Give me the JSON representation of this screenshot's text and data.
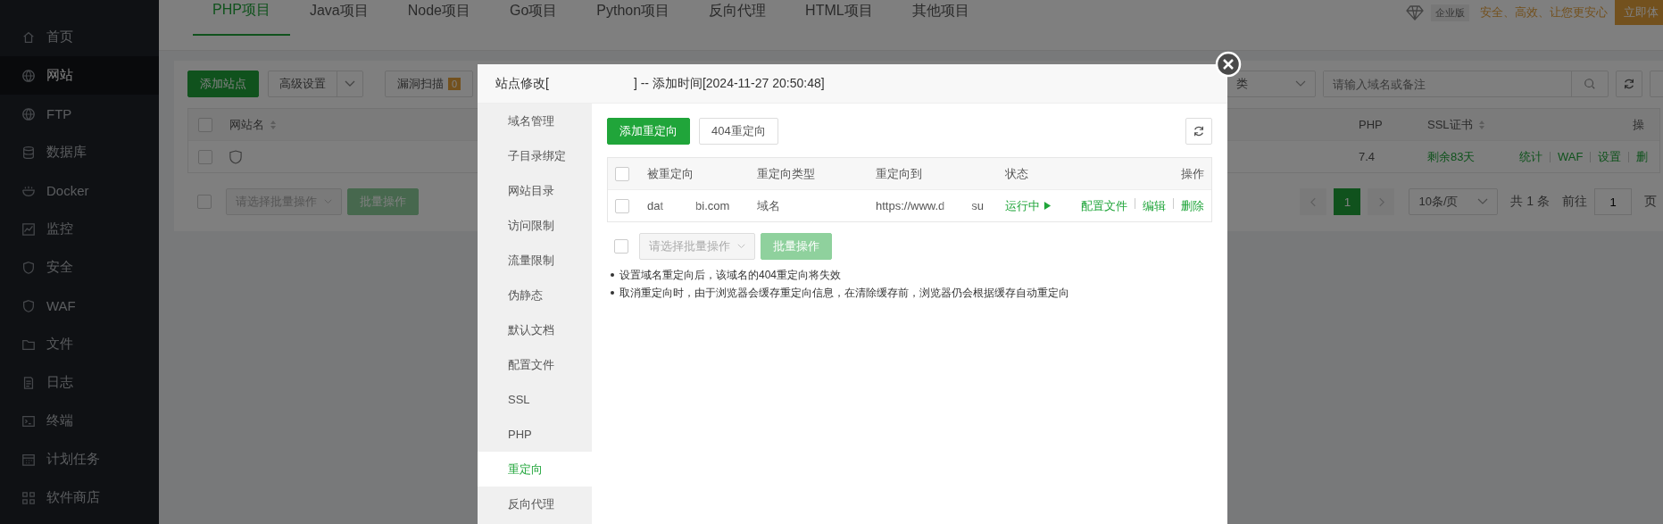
{
  "sidebar": {
    "items": [
      {
        "label": "首页",
        "selected": false
      },
      {
        "label": "网站",
        "selected": true
      },
      {
        "label": "FTP",
        "selected": false
      },
      {
        "label": "数据库",
        "selected": false
      },
      {
        "label": "Docker",
        "selected": false
      },
      {
        "label": "监控",
        "selected": false
      },
      {
        "label": "安全",
        "selected": false
      },
      {
        "label": "WAF",
        "selected": false
      },
      {
        "label": "文件",
        "selected": false
      },
      {
        "label": "日志",
        "selected": false
      },
      {
        "label": "终端",
        "selected": false
      },
      {
        "label": "计划任务",
        "selected": false
      },
      {
        "label": "软件商店",
        "selected": false
      }
    ]
  },
  "top_tabs": [
    {
      "label": "PHP项目",
      "selected": true
    },
    {
      "label": "Java项目",
      "selected": false
    },
    {
      "label": "Node项目",
      "selected": false
    },
    {
      "label": "Go项目",
      "selected": false
    },
    {
      "label": "Python项目",
      "selected": false
    },
    {
      "label": "反向代理",
      "selected": false
    },
    {
      "label": "HTML项目",
      "selected": false
    },
    {
      "label": "其他项目",
      "selected": false
    }
  ],
  "promo": {
    "edition_badge": "企业版",
    "slogan": "安全、高效、让您更安心",
    "button": "立即体"
  },
  "toolbar": {
    "add_site": "添加站点",
    "advanced": "高级设置",
    "scan": "漏洞扫描",
    "scan_count": "0",
    "category_select": "类",
    "search": {
      "placeholder": "请输入域名或备注"
    }
  },
  "site_table": {
    "header_checked": false,
    "columns": [
      {
        "label": "网站名",
        "sortable": true
      },
      {
        "label": "PHP",
        "sortable": false
      },
      {
        "label": "SSL证书",
        "sortable": true
      },
      {
        "label": "操",
        "sortable": false
      }
    ],
    "rows": [
      {
        "checked": false,
        "php": "7.4",
        "ssl": "剩余83天",
        "actions": [
          "统计",
          "WAF",
          "设置",
          "删"
        ]
      }
    ]
  },
  "site_footer": {
    "checked": false,
    "batch_placeholder": "请选择批量操作",
    "batch_button": "批量操作",
    "pages": [
      {
        "label": "1",
        "selected": true
      }
    ],
    "page_size": "10条/页",
    "total": "共 1 条",
    "goto": "前往",
    "goto_value": "1",
    "page_suffix": "页"
  },
  "modal": {
    "title_prefix": "站点修改[",
    "title_suffix": "] -- 添加时间[2024-11-27 20:50:48]",
    "nav": [
      {
        "label": "域名管理",
        "selected": false
      },
      {
        "label": "子目录绑定",
        "selected": false
      },
      {
        "label": "网站目录",
        "selected": false
      },
      {
        "label": "访问限制",
        "selected": false
      },
      {
        "label": "流量限制",
        "selected": false
      },
      {
        "label": "伪静态",
        "selected": false
      },
      {
        "label": "默认文档",
        "selected": false
      },
      {
        "label": "配置文件",
        "selected": false
      },
      {
        "label": "SSL",
        "selected": false
      },
      {
        "label": "PHP",
        "selected": false
      },
      {
        "label": "重定向",
        "selected": true
      },
      {
        "label": "反向代理",
        "selected": false
      }
    ],
    "buttons": [
      "添加重定向",
      "404重定向"
    ],
    "table": {
      "header_checked": false,
      "columns": [
        "被重定向",
        "重定向类型",
        "重定向到",
        "状态",
        "操作"
      ],
      "rows": [
        {
          "checked": false,
          "source_start": "dat",
          "source_end": "bi.com",
          "type": "域名",
          "target_start": "https://www.d",
          "target_end": "su",
          "status": "运行中",
          "running": true,
          "actions": [
            "配置文件",
            "编辑",
            "删除"
          ]
        }
      ]
    },
    "batch": {
      "checked": false,
      "placeholder": "请选择批量操作",
      "button": "批量操作",
      "disabled": true
    },
    "notes": [
      "设置域名重定向后，该域名的404重定向将失效",
      "取消重定向时，由于浏览器会缓存重定向信息，在清除缓存前，浏览器仍会根据缓存自动重定向"
    ]
  }
}
